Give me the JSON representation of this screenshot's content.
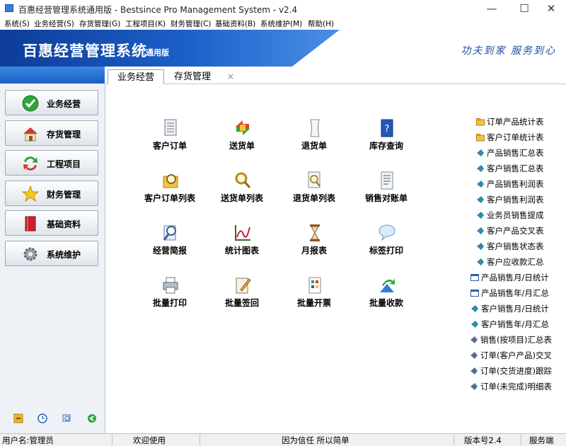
{
  "window": {
    "title": "百惠经营管理系统通用版 - Bestsince Pro Management System - v2.4",
    "controls": {
      "minimize": "—",
      "maximize": "☐",
      "close": "✕"
    }
  },
  "menu": [
    "系统(S)",
    "业务经营(S)",
    "存货管理(G)",
    "工程项目(K)",
    "财务管理(C)",
    "基础资料(B)",
    "系统维护(M)",
    "帮助(H)"
  ],
  "banner": {
    "title": "百惠经营管理系统",
    "subtitle": "通用版",
    "slogan": "功夫到家 服务到心"
  },
  "sidebar": {
    "items": [
      {
        "label": "业务经营",
        "icon": "checkmark-icon"
      },
      {
        "label": "存货管理",
        "icon": "house-icon"
      },
      {
        "label": "工程项目",
        "icon": "cycle-arrows-icon"
      },
      {
        "label": "财务管理",
        "icon": "star-icon"
      },
      {
        "label": "基础资料",
        "icon": "book-icon"
      },
      {
        "label": "系统维护",
        "icon": "gear-icon"
      }
    ],
    "tools": [
      "key-icon",
      "clock-icon",
      "search-icon",
      "back-arrow-icon"
    ]
  },
  "tabs": {
    "items": [
      "业务经营",
      "存货管理"
    ],
    "active": 0,
    "close": "×"
  },
  "tiles": [
    {
      "label": "客户订单",
      "icon": "document-icon"
    },
    {
      "label": "送货单",
      "icon": "delivery-arrows-icon"
    },
    {
      "label": "退货单",
      "icon": "return-paper-icon"
    },
    {
      "label": "库存查询",
      "icon": "help-book-icon"
    },
    {
      "label": "客户订单列表",
      "icon": "folder-search-icon"
    },
    {
      "label": "送货单列表",
      "icon": "magnifier-icon"
    },
    {
      "label": "退货单列表",
      "icon": "page-search-icon"
    },
    {
      "label": "销售对账单",
      "icon": "statement-icon"
    },
    {
      "label": "经营简报",
      "icon": "report-search-icon"
    },
    {
      "label": "统计图表",
      "icon": "line-chart-icon"
    },
    {
      "label": "月报表",
      "icon": "hourglass-icon"
    },
    {
      "label": "标签打印",
      "icon": "speech-bubble-icon"
    },
    {
      "label": "批量打印",
      "icon": "printer-icon"
    },
    {
      "label": "批量签回",
      "icon": "sign-pen-icon"
    },
    {
      "label": "批量开票",
      "icon": "invoice-icon"
    },
    {
      "label": "批量收款",
      "icon": "receipt-arrow-icon"
    }
  ],
  "reports": [
    {
      "label": "订单产品统计表",
      "icon": "folder-icon"
    },
    {
      "label": "客户订单统计表",
      "icon": "folder-icon"
    },
    {
      "label": "产品销售汇总表",
      "icon": "report-icon"
    },
    {
      "label": "客户销售汇总表",
      "icon": "report-icon"
    },
    {
      "label": "产品销售利润表",
      "icon": "report-icon"
    },
    {
      "label": "客户销售利润表",
      "icon": "report-icon"
    },
    {
      "label": "业务员销售提成",
      "icon": "report-icon"
    },
    {
      "label": "客户产品交叉表",
      "icon": "report-icon"
    },
    {
      "label": "客户销售状态表",
      "icon": "report-icon"
    },
    {
      "label": "客户应收款汇总",
      "icon": "report-icon"
    },
    {
      "label": "产品销售月/日统计",
      "icon": "window-icon"
    },
    {
      "label": "产品销售年/月汇总",
      "icon": "window-icon"
    },
    {
      "label": "客户销售月/日统计",
      "icon": "report-icon"
    },
    {
      "label": "客户销售年/月汇总",
      "icon": "report-icon"
    },
    {
      "label": "销售(按项目)汇总表",
      "icon": "report-icon"
    },
    {
      "label": "订单(客户产品)交叉",
      "icon": "report-icon"
    },
    {
      "label": "订单(交货进度)跟踪",
      "icon": "report-icon"
    },
    {
      "label": "订单(未完成)明细表",
      "icon": "report-icon"
    }
  ],
  "status": {
    "user": "用户名:管理员",
    "welcome": "欢迎使用",
    "motto": "因为信任 所以简单",
    "version": "版本号2.4",
    "mode": "服务端"
  }
}
